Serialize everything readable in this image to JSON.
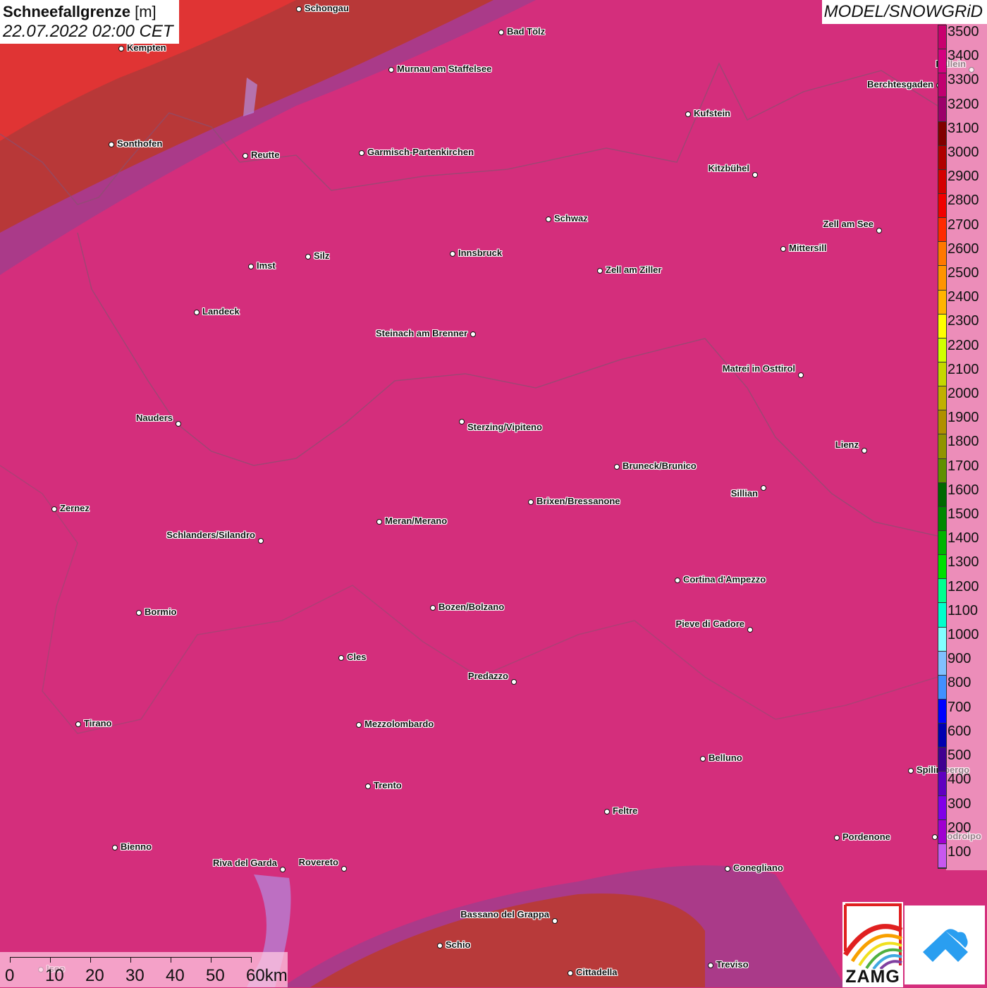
{
  "header": {
    "title": "Schneefallgrenze",
    "unit": "[m]",
    "datetime": "22.07.2022 02:00 CET",
    "model": "MODEL/SNOWGRiD"
  },
  "legend": {
    "labels": [
      "3500",
      "3400",
      "3300",
      "3200",
      "3100",
      "3000",
      "2900",
      "2800",
      "2700",
      "2600",
      "2500",
      "2400",
      "2300",
      "2200",
      "2100",
      "2000",
      "1900",
      "1800",
      "1700",
      "1600",
      "1500",
      "1400",
      "1300",
      "1200",
      "1100",
      "1000",
      "900",
      "800",
      "700",
      "600",
      "500",
      "400",
      "300",
      "200",
      "100"
    ],
    "colors": [
      "#c8006e",
      "#d4007f",
      "#c00070",
      "#9c006a",
      "#800000",
      "#b00000",
      "#d40000",
      "#f00000",
      "#ff2a00",
      "#ff7800",
      "#ff9400",
      "#ffb400",
      "#ffff00",
      "#d0ff00",
      "#c4d800",
      "#c0b000",
      "#b09000",
      "#909400",
      "#609000",
      "#006800",
      "#008800",
      "#00b400",
      "#00e000",
      "#00ff90",
      "#00ffcc",
      "#80ffff",
      "#80c0ff",
      "#4090ff",
      "#0000ff",
      "#0000b0",
      "#400090",
      "#6000c0",
      "#8000e8",
      "#a000d0",
      "#c858f0"
    ]
  },
  "cities": [
    "Schongau",
    "Bad Tölz",
    "Kempten",
    "Murnau am Staffelsee",
    "Hallein",
    "Berchtesgaden",
    "Kufstein",
    "Sonthofen",
    "Reutte",
    "Garmisch-Partenkirchen",
    "Kitzbühel",
    "Schwaz",
    "Zell am See",
    "Mittersill",
    "Innsbruck",
    "Silz",
    "Imst",
    "Zell am Ziller",
    "Landeck",
    "Steinach am Brenner",
    "Matrei in Osttirol",
    "Nauders",
    "Sterzing/Vipiteno",
    "Lienz",
    "Bruneck/Brunico",
    "Sillian",
    "Brixen/Bressanone",
    "Zernez",
    "Meran/Merano",
    "Schlanders/Silandro",
    "Cortina d'Ampezzo",
    "Bozen/Bolzano",
    "Bormio",
    "Pieve di Cadore",
    "Cles",
    "Predazzo",
    "Tirano",
    "Mezzolombardo",
    "Belluno",
    "Spilimbergo",
    "Trento",
    "Feltre",
    "Pordenone",
    "Codroipo",
    "Bienno",
    "Riva del Garda",
    "Rovereto",
    "Conegliano",
    "Bassano del Grappa",
    "Schio",
    "Treviso",
    "Cittadella",
    "Iseo"
  ],
  "scale_bar": {
    "labels": [
      "0",
      "10",
      "20",
      "30",
      "40",
      "50",
      "60km"
    ]
  },
  "logos": {
    "zamg": "ZAMG"
  },
  "colors": {
    "background": "#d42e7c",
    "north_red": "#e03434",
    "band_dark_red": "#b83838",
    "band_purple": "#a23c8c",
    "south_red": "#b83a3a"
  }
}
